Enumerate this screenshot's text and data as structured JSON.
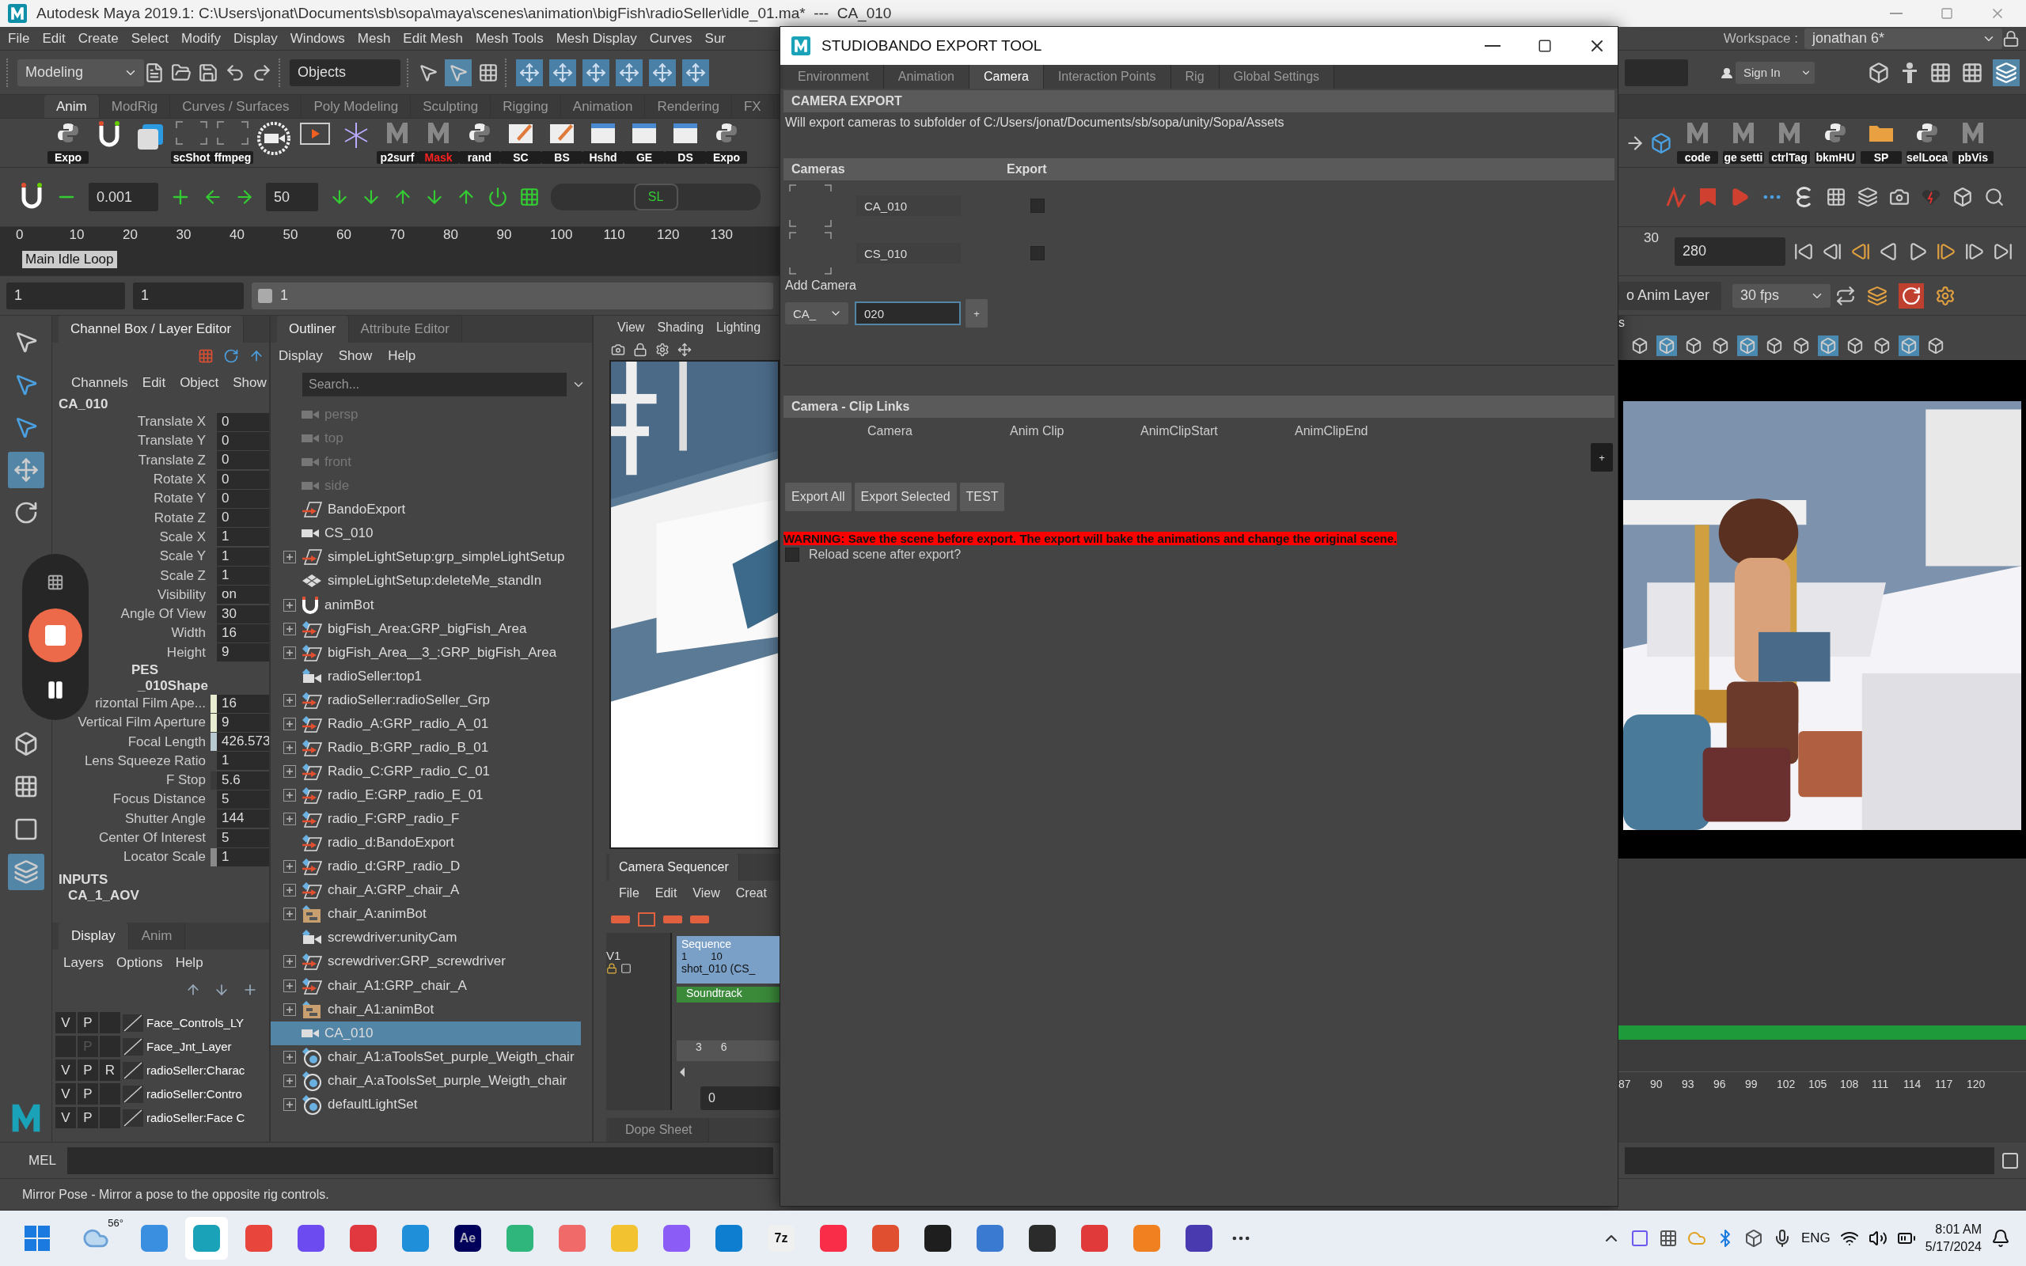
{
  "window": {
    "title": "Autodesk Maya 2019.1: C:\\Users\\jonat\\Documents\\sb\\sopa\\maya\\scenes\\animation\\bigFish\\radioSeller\\idle_01.ma*  ---  CA_010"
  },
  "menu_bar": [
    "File",
    "Edit",
    "Create",
    "Select",
    "Modify",
    "Display",
    "Windows",
    "Mesh",
    "Edit Mesh",
    "Mesh Tools",
    "Mesh Display",
    "Curves",
    "Sur"
  ],
  "status_line": {
    "mode": "Modeling",
    "selection_mode": "Objects"
  },
  "workspace": {
    "label": "Workspace :",
    "value": "jonathan 6*",
    "sign_in": "Sign In"
  },
  "shelf_tabs": [
    {
      "label": "Anim",
      "selected": true
    },
    {
      "label": "ModRig",
      "selected": false
    },
    {
      "label": "Curves / Surfaces",
      "selected": false
    },
    {
      "label": "Poly Modeling",
      "selected": false
    },
    {
      "label": "Sculpting",
      "selected": false
    },
    {
      "label": "Rigging",
      "selected": false
    },
    {
      "label": "Animation",
      "selected": false
    },
    {
      "label": "Rendering",
      "selected": false
    },
    {
      "label": "FX",
      "selected": false
    }
  ],
  "shelf": [
    {
      "kind": "python",
      "label": "Expo"
    },
    {
      "kind": "magnet"
    },
    {
      "kind": "square"
    },
    {
      "kind": "bracket",
      "label": "scShot"
    },
    {
      "kind": "bracket",
      "label": "ffmpeg"
    },
    {
      "kind": "reel"
    },
    {
      "kind": "clip"
    },
    {
      "kind": "star"
    },
    {
      "kind": "maya",
      "label": "p2surf"
    },
    {
      "kind": "maya-warning",
      "label": "Mask"
    },
    {
      "kind": "python",
      "label": "rand"
    },
    {
      "kind": "note",
      "label": "SC"
    },
    {
      "kind": "note",
      "label": "BS"
    },
    {
      "kind": "window",
      "label": "Hshd"
    },
    {
      "kind": "window",
      "label": "GE"
    },
    {
      "kind": "window",
      "label": "DS"
    },
    {
      "kind": "python",
      "label": "Expo"
    }
  ],
  "shelf_right": [
    {
      "kind": "maya",
      "label": "code"
    },
    {
      "kind": "maya",
      "label": "ge setti"
    },
    {
      "kind": "maya",
      "label": "ctrlTag"
    },
    {
      "kind": "python",
      "label": "bkmHU"
    },
    {
      "kind": "folder",
      "label": "SP"
    },
    {
      "kind": "python",
      "label": "selLoca"
    },
    {
      "kind": "maya",
      "label": "pbVis"
    }
  ],
  "anim_toolbar": {
    "step": "0.001",
    "frames": "50",
    "slider": "SL",
    "level": 0.5
  },
  "time_slider": {
    "ticks": [
      "0",
      "10",
      "20",
      "30",
      "40",
      "50",
      "60",
      "70",
      "80",
      "90",
      "100",
      "110",
      "120",
      "130"
    ],
    "clip": "Main Idle Loop",
    "right_tick": "30",
    "end": "280"
  },
  "range_slider": {
    "start": "1",
    "anim_start": "1",
    "range": "1",
    "anim_layer": "o Anim Layer",
    "fps": "30 fps"
  },
  "channel_box": {
    "tab": "Channel Box / Layer Editor",
    "menus": [
      "Channels",
      "Edit",
      "Object",
      "Show"
    ],
    "object": "CA_010",
    "channels": [
      {
        "name": "Translate X",
        "value": "0"
      },
      {
        "name": "Translate Y",
        "value": "0"
      },
      {
        "name": "Translate Z",
        "value": "0"
      },
      {
        "name": "Rotate X",
        "value": "0"
      },
      {
        "name": "Rotate Y",
        "value": "0"
      },
      {
        "name": "Rotate Z",
        "value": "0"
      },
      {
        "name": "Scale X",
        "value": "1"
      },
      {
        "name": "Scale Y",
        "value": "1"
      },
      {
        "name": "Scale Z",
        "value": "1"
      },
      {
        "name": "Visibility",
        "value": "on"
      },
      {
        "name": "Angle Of View",
        "value": "30"
      },
      {
        "name": "Width",
        "value": "16"
      },
      {
        "name": "Height",
        "value": "9"
      }
    ],
    "shapes_header": "PES",
    "shape": "_010Shape",
    "shape_channels": [
      {
        "name": "rizontal Film Ape...",
        "value": "16",
        "color": "#e8ecd0"
      },
      {
        "name": "Vertical Film Aperture",
        "value": "9",
        "color": "#e8ecd0"
      },
      {
        "name": "Focal Length",
        "value": "426.573",
        "color": "#b8c8d0"
      },
      {
        "name": "Lens Squeeze Ratio",
        "value": "1"
      },
      {
        "name": "F Stop",
        "value": "5.6",
        "color": "#3a3a3a"
      },
      {
        "name": "Focus Distance",
        "value": "5"
      },
      {
        "name": "Shutter Angle",
        "value": "144"
      },
      {
        "name": "Center Of Interest",
        "value": "5"
      },
      {
        "name": "Locator Scale",
        "value": "1",
        "color": "#8a8a8a"
      }
    ],
    "inputs_header": "INPUTS",
    "input": "CA_1_AOV"
  },
  "layer_editor": {
    "tabs": [
      {
        "label": "Display",
        "selected": true
      },
      {
        "label": "Anim",
        "selected": false
      }
    ],
    "menus": [
      "Layers",
      "Options",
      "Help"
    ],
    "layers": [
      {
        "visible": "V",
        "playback": "P",
        "dim": false,
        "name": "Face_Controls_LY"
      },
      {
        "playback": "P",
        "dim": true,
        "name": "Face_Jnt_Layer"
      },
      {
        "visible": "V",
        "playback": "P",
        "reference": "R",
        "dim": false,
        "name": "radioSeller:Charac"
      },
      {
        "visible": "V",
        "playback": "P",
        "dim": false,
        "name": "radioSeller:Contro"
      },
      {
        "visible": "V",
        "playback": "P",
        "dim": false,
        "name": "radioSeller:Face C"
      }
    ]
  },
  "outliner": {
    "tabs": [
      {
        "label": "Outliner",
        "selected": true
      },
      {
        "label": "Attribute Editor",
        "selected": false
      }
    ],
    "menus": [
      "Display",
      "Show",
      "Help"
    ],
    "search": {
      "placeholder": "Search..."
    },
    "items": [
      {
        "name": "persp",
        "kind": "camera",
        "dim": true,
        "expandable": false,
        "selected": false
      },
      {
        "name": "top",
        "kind": "camera",
        "dim": true,
        "expandable": false,
        "selected": false
      },
      {
        "name": "front",
        "kind": "camera",
        "dim": true,
        "expandable": false,
        "selected": false
      },
      {
        "name": "side",
        "kind": "camera",
        "dim": true,
        "expandable": false,
        "selected": false
      },
      {
        "name": "BandoExport",
        "kind": "transform",
        "dim": false,
        "expandable": false,
        "selected": false
      },
      {
        "name": "CS_010",
        "kind": "camera",
        "dim": false,
        "expandable": false,
        "selected": false
      },
      {
        "name": "simpleLightSetup:grp_simpleLightSetup",
        "kind": "transform",
        "dim": false,
        "expandable": true,
        "selected": false
      },
      {
        "name": "simpleLightSetup:deleteMe_standIn",
        "kind": "mesh",
        "dim": false,
        "expandable": false,
        "selected": false
      },
      {
        "name": "animBot",
        "kind": "magnet",
        "dim": false,
        "expandable": true,
        "selected": false
      },
      {
        "name": "bigFish_Area:GRP_bigFish_Area",
        "kind": "ref-transform",
        "dim": false,
        "expandable": true,
        "selected": false
      },
      {
        "name": "bigFish_Area__3_:GRP_bigFish_Area",
        "kind": "ref-transform",
        "dim": false,
        "expandable": true,
        "selected": false
      },
      {
        "name": "radioSeller:top1",
        "kind": "ref-camera",
        "dim": false,
        "expandable": false,
        "selected": false
      },
      {
        "name": "radioSeller:radioSeller_Grp",
        "kind": "ref-transform",
        "dim": false,
        "expandable": true,
        "selected": false
      },
      {
        "name": "Radio_A:GRP_radio_A_01",
        "kind": "ref-transform",
        "dim": false,
        "expandable": true,
        "selected": false
      },
      {
        "name": "Radio_B:GRP_radio_B_01",
        "kind": "ref-transform",
        "dim": false,
        "expandable": true,
        "selected": false
      },
      {
        "name": "Radio_C:GRP_radio_C_01",
        "kind": "ref-transform",
        "dim": false,
        "expandable": true,
        "selected": false
      },
      {
        "name": "radio_E:GRP_radio_E_01",
        "kind": "ref-transform",
        "dim": false,
        "expandable": true,
        "selected": false
      },
      {
        "name": "radio_F:GRP_radio_F",
        "kind": "ref-transform",
        "dim": false,
        "expandable": true,
        "selected": false
      },
      {
        "name": "radio_d:BandoExport",
        "kind": "ref-transform",
        "dim": false,
        "expandable": false,
        "selected": false
      },
      {
        "name": "radio_d:GRP_radio_D",
        "kind": "ref-transform",
        "dim": false,
        "expandable": true,
        "selected": false
      },
      {
        "name": "chair_A:GRP_chair_A",
        "kind": "ref-transform",
        "dim": false,
        "expandable": true,
        "selected": false
      },
      {
        "name": "chair_A:animBot",
        "kind": "ref-node",
        "dim": false,
        "expandable": true,
        "selected": false
      },
      {
        "name": "screwdriver:unityCam",
        "kind": "ref-camera",
        "dim": false,
        "expandable": false,
        "selected": false
      },
      {
        "name": "screwdriver:GRP_screwdriver",
        "kind": "ref-transform",
        "dim": false,
        "expandable": true,
        "selected": false
      },
      {
        "name": "chair_A1:GRP_chair_A",
        "kind": "ref-transform",
        "dim": false,
        "expandable": true,
        "selected": false
      },
      {
        "name": "chair_A1:animBot",
        "kind": "ref-node",
        "dim": false,
        "expandable": true,
        "selected": false
      },
      {
        "name": "CA_010",
        "kind": "camera",
        "dim": false,
        "expandable": false,
        "selected": true
      },
      {
        "name": "chair_A1:aToolsSet_purple_Weigth_chair",
        "kind": "set",
        "dim": false,
        "expandable": true,
        "selected": false
      },
      {
        "name": "chair_A:aToolsSet_purple_Weigth_chair",
        "kind": "set",
        "dim": false,
        "expandable": true,
        "selected": false
      },
      {
        "name": "defaultLightSet",
        "kind": "set",
        "dim": false,
        "expandable": true,
        "selected": false
      }
    ]
  },
  "viewport_left": {
    "menus": [
      "View",
      "Shading",
      "Lighting"
    ]
  },
  "camera_sequencer": {
    "tab": "Camera Sequencer",
    "menus": [
      "File",
      "Edit",
      "View",
      "Creat"
    ],
    "track": "V1",
    "sequence": "Sequence",
    "shot_start": "1",
    "shot_mark": "10",
    "shot": "shot_010 (CS_",
    "soundtrack": "Soundtrack",
    "ticks": [
      "3",
      "6"
    ],
    "frame": "0",
    "bottom_tab": "Dope Sheet"
  },
  "viewport_right": {
    "menu_fragment": "s"
  },
  "graph": {
    "ticks": [
      "87",
      "90",
      "93",
      "96",
      "99",
      "102",
      "105",
      "108",
      "111",
      "114",
      "117",
      "120"
    ]
  },
  "command_line": {
    "language": "MEL"
  },
  "help_line": "Mirror Pose - Mirror a pose to the opposite rig controls.",
  "export_tool": {
    "title": "STUDIOBANDO EXPORT TOOL",
    "tabs": [
      {
        "label": "Environment",
        "selected": false
      },
      {
        "label": "Animation",
        "selected": false
      },
      {
        "label": "Camera",
        "selected": true
      },
      {
        "label": "Interaction Points",
        "selected": false
      },
      {
        "label": "Rig",
        "selected": false
      },
      {
        "label": "Global Settings",
        "selected": false
      }
    ],
    "section": "CAMERA EXPORT",
    "note": "Will export cameras to subfolder of C:/Users/jonat/Documents/sb/sopa/unity/Sopa/Assets",
    "cameras_header": {
      "name": "Cameras",
      "export": "Export"
    },
    "cameras": [
      {
        "name": "CA_010",
        "export": false
      },
      {
        "name": "CS_010",
        "export": false
      }
    ],
    "add_camera": {
      "label": "Add Camera",
      "prefix": "CA_",
      "number": "020",
      "add": "+"
    },
    "clip_links": {
      "title": "Camera - Clip Links",
      "columns": [
        "Camera",
        "Anim Clip",
        "AnimClipStart",
        "AnimClipEnd"
      ],
      "add": "+"
    },
    "buttons": [
      "Export All",
      "Export Selected",
      "TEST"
    ],
    "warning": "WARNING: Save the scene before export. The export will bake the animations and change the original scene.",
    "reload": {
      "label": "Reload scene after export?",
      "checked": false
    }
  },
  "taskbar": {
    "weather": "56°",
    "apps": [
      {
        "color": "#3b8fe0",
        "selected": false
      },
      {
        "color": "#1aa3b8",
        "selected": true
      },
      {
        "color": "#e8453c",
        "selected": false
      },
      {
        "color": "#6c4cf0",
        "selected": false
      },
      {
        "color": "#e0383e",
        "selected": false
      },
      {
        "color": "#1e8fd8",
        "selected": false
      },
      {
        "color": "#00005b",
        "label": "Ae",
        "selected": false
      },
      {
        "color": "#2eb67d",
        "selected": false
      },
      {
        "color": "#f06a6a",
        "selected": false
      },
      {
        "color": "#f2c230",
        "selected": false
      },
      {
        "color": "#8b5cf6",
        "selected": false
      },
      {
        "color": "#0e7fd0",
        "selected": false
      },
      {
        "color": "#f0f0f0",
        "label": "7z",
        "selected": false
      },
      {
        "color": "#fa2d48",
        "selected": false
      },
      {
        "color": "#e05030",
        "selected": false
      },
      {
        "color": "#1e1e1e",
        "selected": false
      },
      {
        "color": "#3a7ad0",
        "selected": false
      },
      {
        "color": "#2b2b2b",
        "selected": false
      },
      {
        "color": "#e03a3a",
        "selected": false
      },
      {
        "color": "#f08020",
        "selected": false
      },
      {
        "color": "#4a3ab0",
        "selected": false
      }
    ],
    "language": "ENG",
    "time": "8:01 AM",
    "date": "5/17/2024"
  }
}
